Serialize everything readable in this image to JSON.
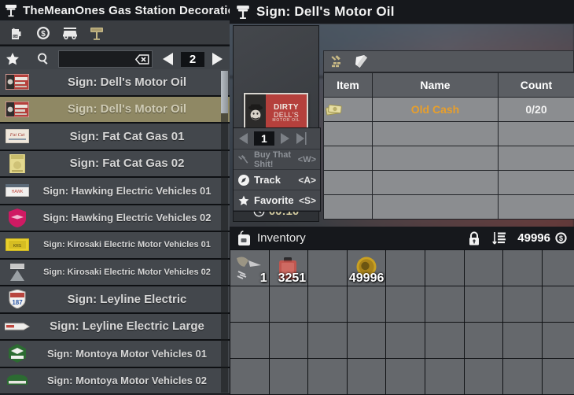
{
  "window": {
    "left_title": "TheMeanOnes Gas Station Decorations",
    "left_icon": "sign-post-icon",
    "right_title": "Sign: Dell's Motor Oil",
    "right_icon": "sign-post-icon"
  },
  "categories": [
    {
      "name": "gas-can-icon",
      "label": "Gas",
      "selected": false
    },
    {
      "name": "dollar-coin-icon",
      "label": "Money",
      "selected": false
    },
    {
      "name": "vehicle-icon",
      "label": "Vehicles",
      "selected": false
    },
    {
      "name": "sign-post-icon",
      "label": "Signs",
      "selected": true
    }
  ],
  "search": {
    "favorite_icon": "star-icon",
    "search_icon": "magnifier-icon",
    "value": "",
    "placeholder": "",
    "clear_icon": "clear-x-icon",
    "prev_icon": "triangle-left-icon",
    "page": "2",
    "next_icon": "triangle-right-icon"
  },
  "list": {
    "items": [
      {
        "label": "Sign: Dell's Motor Oil",
        "size": "s15",
        "selected": false,
        "thumb": "dirty-dells-sign"
      },
      {
        "label": "Sign: Dell's Motor Oil",
        "size": "s15",
        "selected": true,
        "thumb": "dirty-dells-sign"
      },
      {
        "label": "Sign: Fat Cat Gas 01",
        "size": "s15",
        "selected": false,
        "thumb": "fat-cat-01-sign"
      },
      {
        "label": "Sign: Fat Cat Gas 02",
        "size": "s15",
        "selected": false,
        "thumb": "fat-cat-02-sign"
      },
      {
        "label": "Sign: Hawking Electric Vehicles 01",
        "size": "s13",
        "selected": false,
        "thumb": "hawking-01-sign"
      },
      {
        "label": "Sign: Hawking Electric Vehicles 02",
        "size": "s13",
        "selected": false,
        "thumb": "hawking-02-sign"
      },
      {
        "label": "Sign: Kirosaki Electric Motor Vehicles 01",
        "size": "s11",
        "selected": false,
        "thumb": "kirosaki-01-sign"
      },
      {
        "label": "Sign: Kirosaki Electric Motor Vehicles 02",
        "size": "s11",
        "selected": false,
        "thumb": "kirosaki-02-sign"
      },
      {
        "label": "Sign: Leyline Electric",
        "size": "s15",
        "selected": false,
        "thumb": "leyline-shield-sign"
      },
      {
        "label": "Sign: Leyline Electric Large",
        "size": "s15",
        "selected": false,
        "thumb": "leyline-large-sign"
      },
      {
        "label": "Sign: Montoya Motor Vehicles 01",
        "size": "s13",
        "selected": false,
        "thumb": "montoya-01-sign"
      },
      {
        "label": "Sign: Montoya Motor Vehicles 02",
        "size": "s13",
        "selected": false,
        "thumb": "montoya-02-sign"
      }
    ]
  },
  "recipe": {
    "preview": {
      "sign_line1": "DIRTY",
      "sign_line2": "DELL'S",
      "sign_line3": "MOTOR OIL"
    },
    "timer_icon": "clock-icon",
    "timer": "00:10",
    "count": "1",
    "count_prev_icon": "triangle-left-icon",
    "count_next_icon": "triangle-right-icon",
    "count_max_icon": "triangle-right-bar-icon",
    "actions": [
      {
        "icon": "hammer-icon",
        "label": "Buy That Shit!",
        "key": "<W>",
        "dim": true
      },
      {
        "icon": "track-icon",
        "label": "Track",
        "key": "<A>",
        "dim": false
      },
      {
        "icon": "star-icon",
        "label": "Favorite",
        "key": "<S>",
        "dim": false
      }
    ],
    "tabs": [
      {
        "name": "craft-tab-icon",
        "selected": true
      },
      {
        "name": "book-tab-icon",
        "selected": false
      }
    ],
    "table": {
      "headers": [
        "Item",
        "Name",
        "Count"
      ],
      "rows": [
        {
          "icon": "old-cash-icon",
          "name": "Old Cash",
          "count": "0/20"
        },
        {
          "icon": "",
          "name": "",
          "count": ""
        },
        {
          "icon": "",
          "name": "",
          "count": ""
        },
        {
          "icon": "",
          "name": "",
          "count": ""
        },
        {
          "icon": "",
          "name": "",
          "count": ""
        }
      ]
    }
  },
  "inventory": {
    "icon": "backpack-icon",
    "title": "Inventory",
    "lock_icon": "lock-icon",
    "sort_icon": "sort-descending-icon",
    "currency": "49996",
    "currency_icon": "dollar-coin-icon",
    "columns": 9,
    "rows": 4,
    "slots": [
      {
        "index": 0,
        "item": "animal-trap-icon",
        "qty": "1"
      },
      {
        "index": 1,
        "item": "gas-can-icon",
        "qty": "3251"
      },
      {
        "index": 3,
        "item": "gold-coin-icon",
        "qty": "49996"
      }
    ]
  },
  "colors": {
    "accent_gold": "#e89f2b",
    "selected_row": "#8f8864",
    "panel_header": "#16181c",
    "timer_text": "#cfc79d",
    "table_row": "#8b8d90"
  }
}
